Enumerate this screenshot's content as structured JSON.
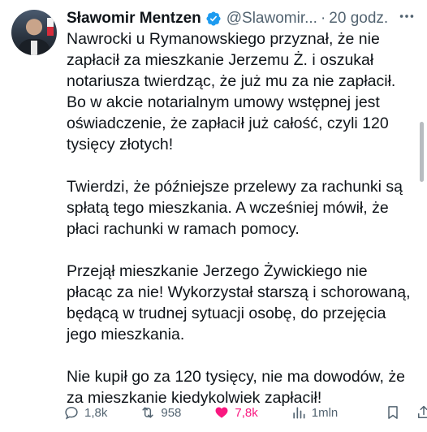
{
  "author": {
    "name": "Sławomir Mentzen",
    "handle": "@Slawomir...",
    "separator": "·",
    "time": "20 godz."
  },
  "tweet": {
    "paragraphs": [
      "Nawrocki u Rymanowskiego przyznał, że nie zapłacił za mieszkanie Jerzemu Ż. i oszukał notariusza twierdząc, że już mu za nie zapłacił. Bo w akcie notarialnym umowy wstępnej jest oświadczenie, że zapłacił już całość, czyli 120 tysięcy złotych!",
      "Twierdzi, że późniejsze przelewy za rachunki są spłatą tego mieszkania. A wcześniej mówił, że płaci rachunki w ramach pomocy.",
      "Przejął mieszkanie Jerzego Żywickiego nie płacąc za nie! Wykorzystał starszą i schorowaną, będącą w trudnej sytuacji osobę, do przejęcia jego mieszkania.",
      "Nie kupił go za 120 tysięcy, nie ma dowodów, że za mieszkanie kiedykolwiek zapłacił!"
    ]
  },
  "stats": {
    "replies": "1,8k",
    "reposts": "958",
    "likes": "7,8k",
    "views": "1mln"
  },
  "icons": {
    "verified": "verified-badge-icon",
    "more": "more-options-icon",
    "reply": "reply-icon",
    "repost": "repost-icon",
    "like": "heart-icon",
    "views": "views-chart-icon",
    "bookmark": "bookmark-icon",
    "share": "share-icon"
  },
  "colors": {
    "verified": "#1d9bf0",
    "like_active": "#f91880",
    "secondary_text": "#536471",
    "primary_text": "#0f1419"
  }
}
